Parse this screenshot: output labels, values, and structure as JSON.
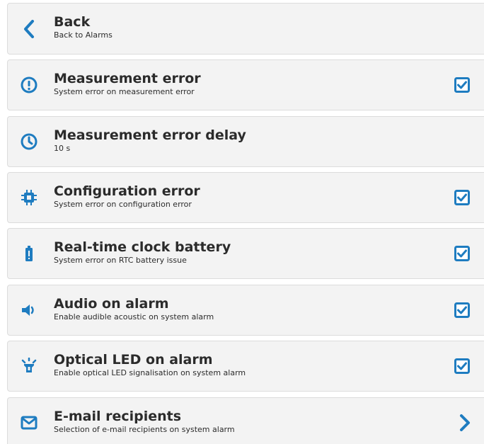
{
  "colors": {
    "accent": "#1e7cc0",
    "row_bg": "#f3f3f3",
    "row_border": "#dcdcdc",
    "text": "#2b2b2b"
  },
  "back": {
    "title": "Back",
    "subtitle": "Back to Alarms",
    "icon": "chevron-left-icon"
  },
  "items": [
    {
      "title": "Measurement error",
      "subtitle": "System error on measurement error",
      "icon": "exclamation-circle-icon",
      "checked": true
    },
    {
      "title": "Measurement error delay",
      "subtitle": "10 s",
      "icon": "clock-icon"
    },
    {
      "title": "Configuration error",
      "subtitle": "System error on configuration error",
      "icon": "chip-icon",
      "checked": true
    },
    {
      "title": "Real-time clock battery",
      "subtitle": "System error on RTC battery issue",
      "icon": "battery-alert-icon",
      "checked": true
    },
    {
      "title": "Audio on alarm",
      "subtitle": "Enable audible acoustic on system alarm",
      "icon": "speaker-icon",
      "checked": true
    },
    {
      "title": "Optical LED on alarm",
      "subtitle": "Enable optical LED signalisation on system alarm",
      "icon": "beacon-icon",
      "checked": true
    },
    {
      "title": "E-mail recipients",
      "subtitle": "Selection of e-mail recipients on system alarm",
      "icon": "envelope-icon",
      "action": "chevron-right-icon"
    }
  ]
}
